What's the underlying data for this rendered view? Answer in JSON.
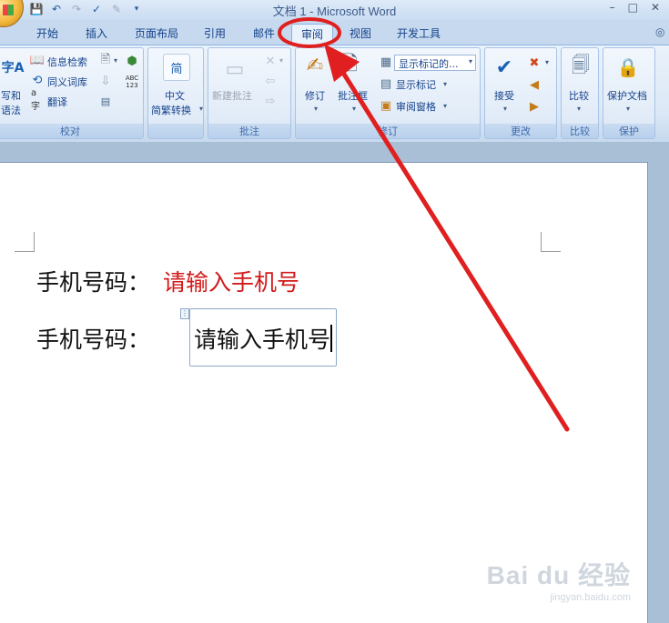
{
  "window": {
    "title": "文档 1 - Microsoft Word",
    "controls": [
      "–",
      "□",
      "✕"
    ]
  },
  "qat": {
    "icons": [
      "save-icon",
      "undo-icon",
      "redo-icon",
      "spelling-icon",
      "format-painter-icon"
    ]
  },
  "tabs": [
    "开始",
    "插入",
    "页面布局",
    "引用",
    "邮件",
    "审阅",
    "视图",
    "开发工具"
  ],
  "active_tab": "审阅",
  "ribbon": {
    "proofing": {
      "label": "校对",
      "spelling_line1": "写和",
      "spelling_line2": "语法",
      "research": "信息检索",
      "thesaurus": "同义词库",
      "translate": "翻译",
      "abc": "ABC\n123"
    },
    "chinese": {
      "label": "中文",
      "sublabel": "简繁转换",
      "icon_char": "简"
    },
    "comments": {
      "label": "批注",
      "new_comment": "新建批注"
    },
    "tracking": {
      "label": "修订",
      "track_changes": "修订",
      "balloons": "批注框",
      "show_markup_select": "显示标记的...",
      "show_markup": "显示标记",
      "reviewing_pane": "审阅窗格"
    },
    "changes": {
      "label": "更改",
      "accept": "接受"
    },
    "compare": {
      "label": "比较"
    },
    "protect": {
      "label": "保护",
      "protect_doc": "保护文档"
    }
  },
  "document": {
    "line1_label": "手机号码：",
    "line1_value": "请输入手机号",
    "line2_label": "手机号码：",
    "line2_value": "请输入手机号"
  },
  "colors": {
    "annotation": "#e02020",
    "field_red": "#d21a1a"
  },
  "watermark": {
    "brand": "Bai du 经验",
    "url": "jingyan.baidu.com"
  }
}
